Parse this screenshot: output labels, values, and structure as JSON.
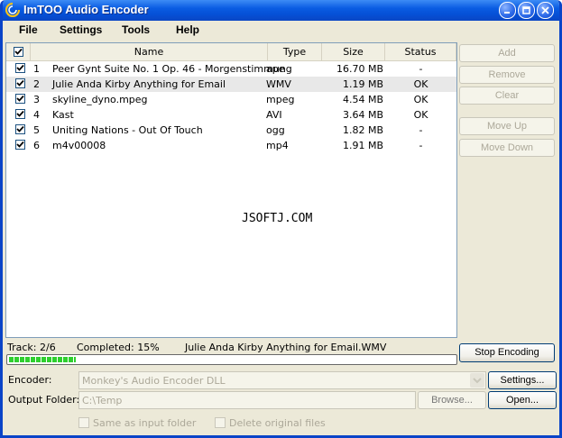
{
  "window": {
    "title": "ImTOO Audio Encoder"
  },
  "menu": [
    "File",
    "Settings",
    "Tools",
    "Help"
  ],
  "table": {
    "headers": {
      "name": "Name",
      "type": "Type",
      "size": "Size",
      "status": "Status"
    },
    "rows": [
      {
        "num": "1",
        "name": "Peer Gynt Suite No. 1 Op. 46 - Morgenstimmung",
        "type": "ape",
        "size": "16.70 MB",
        "status": "-"
      },
      {
        "num": "2",
        "name": "Julie Anda Kirby Anything for Email",
        "type": "WMV",
        "size": "1.19 MB",
        "status": "OK"
      },
      {
        "num": "3",
        "name": "skyline_dyno.mpeg",
        "type": "mpeg",
        "size": "4.54 MB",
        "status": "OK"
      },
      {
        "num": "4",
        "name": "Kast",
        "type": "AVI",
        "size": "3.64 MB",
        "status": "OK"
      },
      {
        "num": "5",
        "name": "Uniting Nations - Out Of Touch",
        "type": "ogg",
        "size": "1.82 MB",
        "status": "-"
      },
      {
        "num": "6",
        "name": "m4v00008",
        "type": "mp4",
        "size": "1.91 MB",
        "status": "-"
      }
    ]
  },
  "watermark": "JSOFTJ.COM",
  "side_buttons": {
    "add": "Add",
    "remove": "Remove",
    "clear": "Clear",
    "move_up": "Move Up",
    "move_down": "Move Down"
  },
  "status": {
    "track": "Track: 2/6",
    "completed": "Completed: 15%",
    "file": "Julie Anda Kirby Anything for Email.WMV",
    "progress": 0.15
  },
  "stop_button": "Stop Encoding",
  "encoder": {
    "label": "Encoder:",
    "value": "Monkey's Audio Encoder DLL",
    "settings_button": "Settings..."
  },
  "output": {
    "label": "Output Folder:",
    "value": "C:\\Temp",
    "browse_button": "Browse...",
    "open_button": "Open..."
  },
  "options": {
    "same_as_input": "Same as input folder",
    "delete_original": "Delete original files"
  }
}
